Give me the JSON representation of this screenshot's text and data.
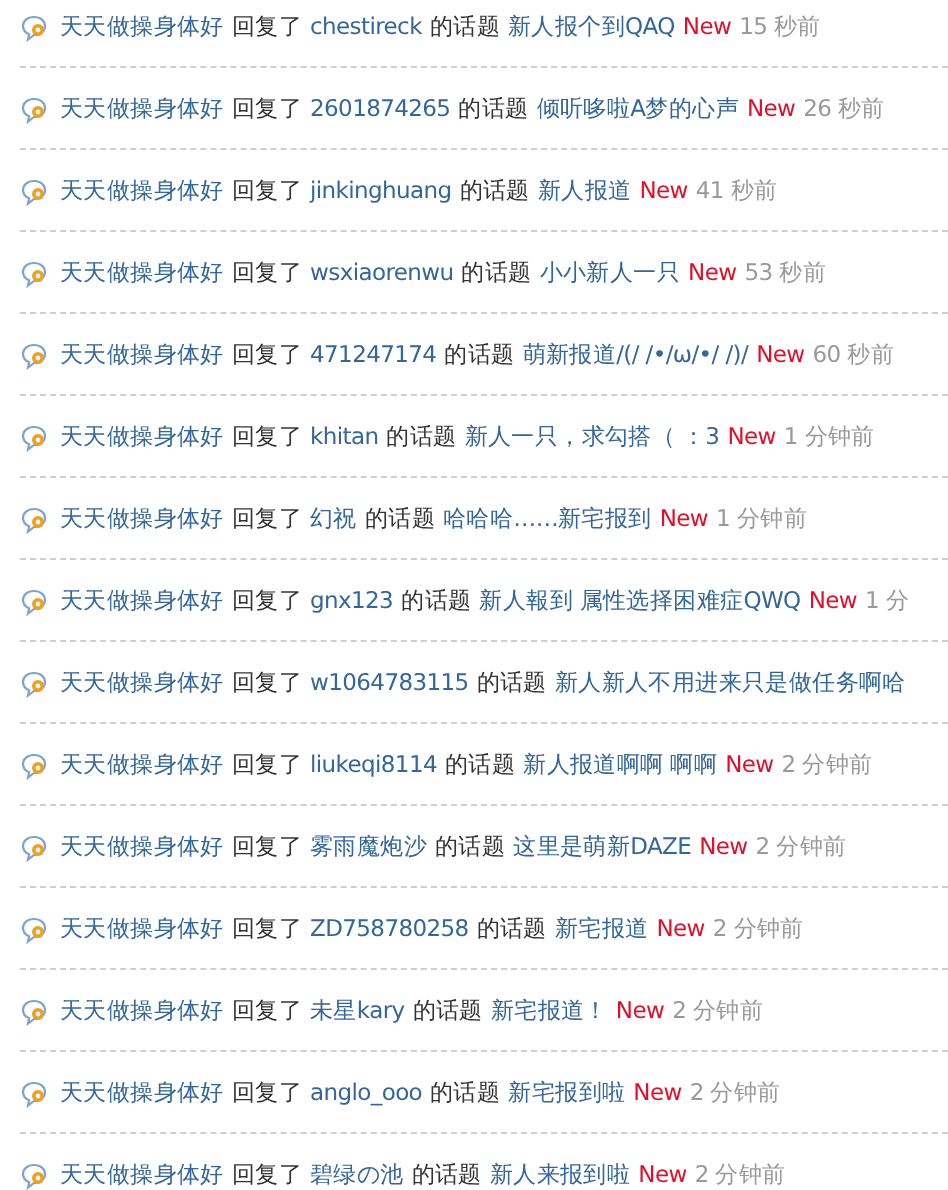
{
  "feed": [
    {
      "user": "天天做操身体好",
      "action": "回复了",
      "author": "chestireck",
      "topic_label": "的话题",
      "title": "新人报个到QAQ",
      "badge": "New",
      "time": "15 秒前"
    },
    {
      "user": "天天做操身体好",
      "action": "回复了",
      "author": "2601874265",
      "topic_label": "的话题",
      "title": "倾听哆啦A梦的心声",
      "badge": "New",
      "time": "26 秒前"
    },
    {
      "user": "天天做操身体好",
      "action": "回复了",
      "author": "jinkinghuang",
      "topic_label": "的话题",
      "title": "新人报道",
      "badge": "New",
      "time": "41 秒前"
    },
    {
      "user": "天天做操身体好",
      "action": "回复了",
      "author": "wsxiaorenwu",
      "topic_label": "的话题",
      "title": "小小新人一只",
      "badge": "New",
      "time": "53 秒前"
    },
    {
      "user": "天天做操身体好",
      "action": "回复了",
      "author": "471247174",
      "topic_label": "的话题",
      "title": "萌新报道/(/ /•/ω/•/ /)/",
      "badge": "New",
      "time": "60 秒前"
    },
    {
      "user": "天天做操身体好",
      "action": "回复了",
      "author": "khitan",
      "topic_label": "的话题",
      "title": "新人一只，求勾搭（ ：3",
      "badge": "New",
      "time": "1 分钟前"
    },
    {
      "user": "天天做操身体好",
      "action": "回复了",
      "author": "幻祝",
      "topic_label": "的话题",
      "title": "哈哈哈……新宅报到",
      "badge": "New",
      "time": "1 分钟前"
    },
    {
      "user": "天天做操身体好",
      "action": "回复了",
      "author": "gnx123",
      "topic_label": "的话题",
      "title": "新人報到 属性选择困难症QWQ",
      "badge": "New",
      "time": "1 分"
    },
    {
      "user": "天天做操身体好",
      "action": "回复了",
      "author": "w1064783115",
      "topic_label": "的话题",
      "title": "新人新人不用进来只是做任务啊哈"
    },
    {
      "user": "天天做操身体好",
      "action": "回复了",
      "author": "liukeqi8114",
      "topic_label": "的话题",
      "title": "新人报道啊啊 啊啊",
      "badge": "New",
      "time": "2 分钟前"
    },
    {
      "user": "天天做操身体好",
      "action": "回复了",
      "author": "雾雨魔炮沙",
      "topic_label": "的话题",
      "title": "这里是萌新DAZE",
      "badge": "New",
      "time": "2 分钟前"
    },
    {
      "user": "天天做操身体好",
      "action": "回复了",
      "author": "ZD758780258",
      "topic_label": "的话题",
      "title": "新宅报道",
      "badge": "New",
      "time": "2 分钟前"
    },
    {
      "user": "天天做操身体好",
      "action": "回复了",
      "author": "未星kary",
      "topic_label": "的话题",
      "title": "新宅报道！",
      "badge": "New",
      "time": "2 分钟前"
    },
    {
      "user": "天天做操身体好",
      "action": "回复了",
      "author": "anglo_ooo",
      "topic_label": "的话题",
      "title": "新宅报到啦",
      "badge": "New",
      "time": "2 分钟前"
    },
    {
      "user": "天天做操身体好",
      "action": "回复了",
      "author": "碧绿の池",
      "topic_label": "的话题",
      "title": "新人来报到啦",
      "badge": "New",
      "time": "2 分钟前"
    }
  ]
}
